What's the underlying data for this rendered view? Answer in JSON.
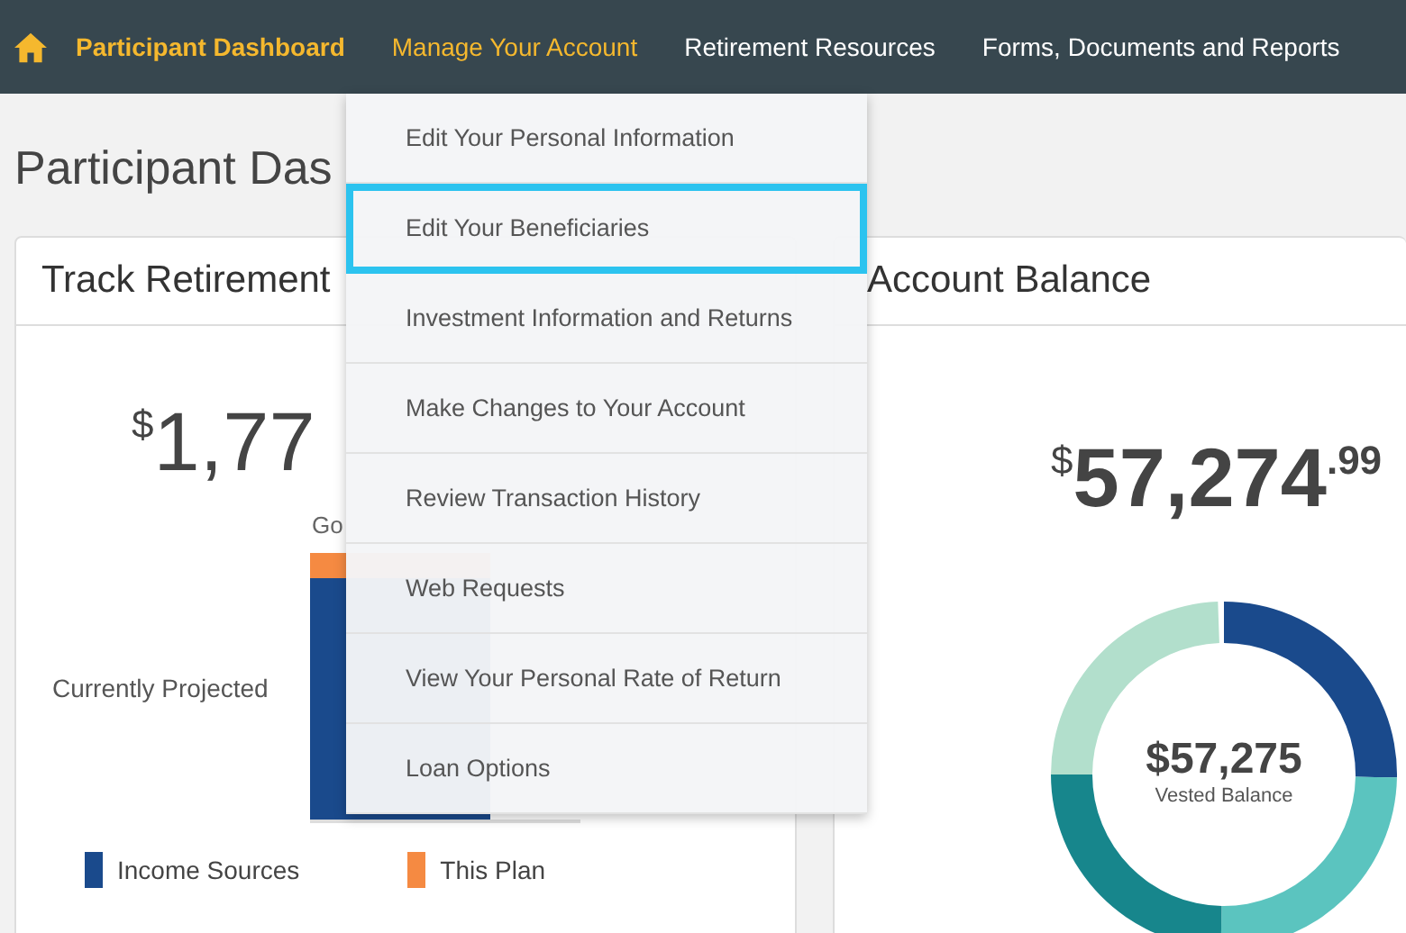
{
  "nav": {
    "items": [
      {
        "label": "Participant Dashboard",
        "selected": true,
        "expanded": false
      },
      {
        "label": "Manage Your Account",
        "selected": false,
        "expanded": true
      },
      {
        "label": "Retirement Resources",
        "selected": false,
        "expanded": false
      },
      {
        "label": "Forms, Documents and Reports",
        "selected": false,
        "expanded": false
      }
    ]
  },
  "dropdown": {
    "items": [
      {
        "label": "Edit Your Personal Information",
        "selected": false
      },
      {
        "label": "Edit Your Beneficiaries",
        "selected": true
      },
      {
        "label": "Investment Information and Returns",
        "selected": false
      },
      {
        "label": "Make Changes to Your Account",
        "selected": false
      },
      {
        "label": "Review Transaction History",
        "selected": false
      },
      {
        "label": "Web Requests",
        "selected": false
      },
      {
        "label": "View Your Personal Rate of Return",
        "selected": false
      },
      {
        "label": "Loan Options",
        "selected": false
      }
    ]
  },
  "page_title": "Participant Das",
  "track_card": {
    "title": "Track Retirement",
    "currency": "$",
    "amount": "1,77",
    "goal": "Go",
    "bar_label": "Currently Projected",
    "legend": [
      {
        "label": "Income Sources",
        "color": "#1a4a8c"
      },
      {
        "label": "This Plan",
        "color": "#f58a42"
      }
    ]
  },
  "balance_card": {
    "title": "Account Balance",
    "currency": "$",
    "amount": "57,274",
    "cents": ".99",
    "donut_value": "$57,275",
    "donut_label": "Vested Balance"
  }
}
